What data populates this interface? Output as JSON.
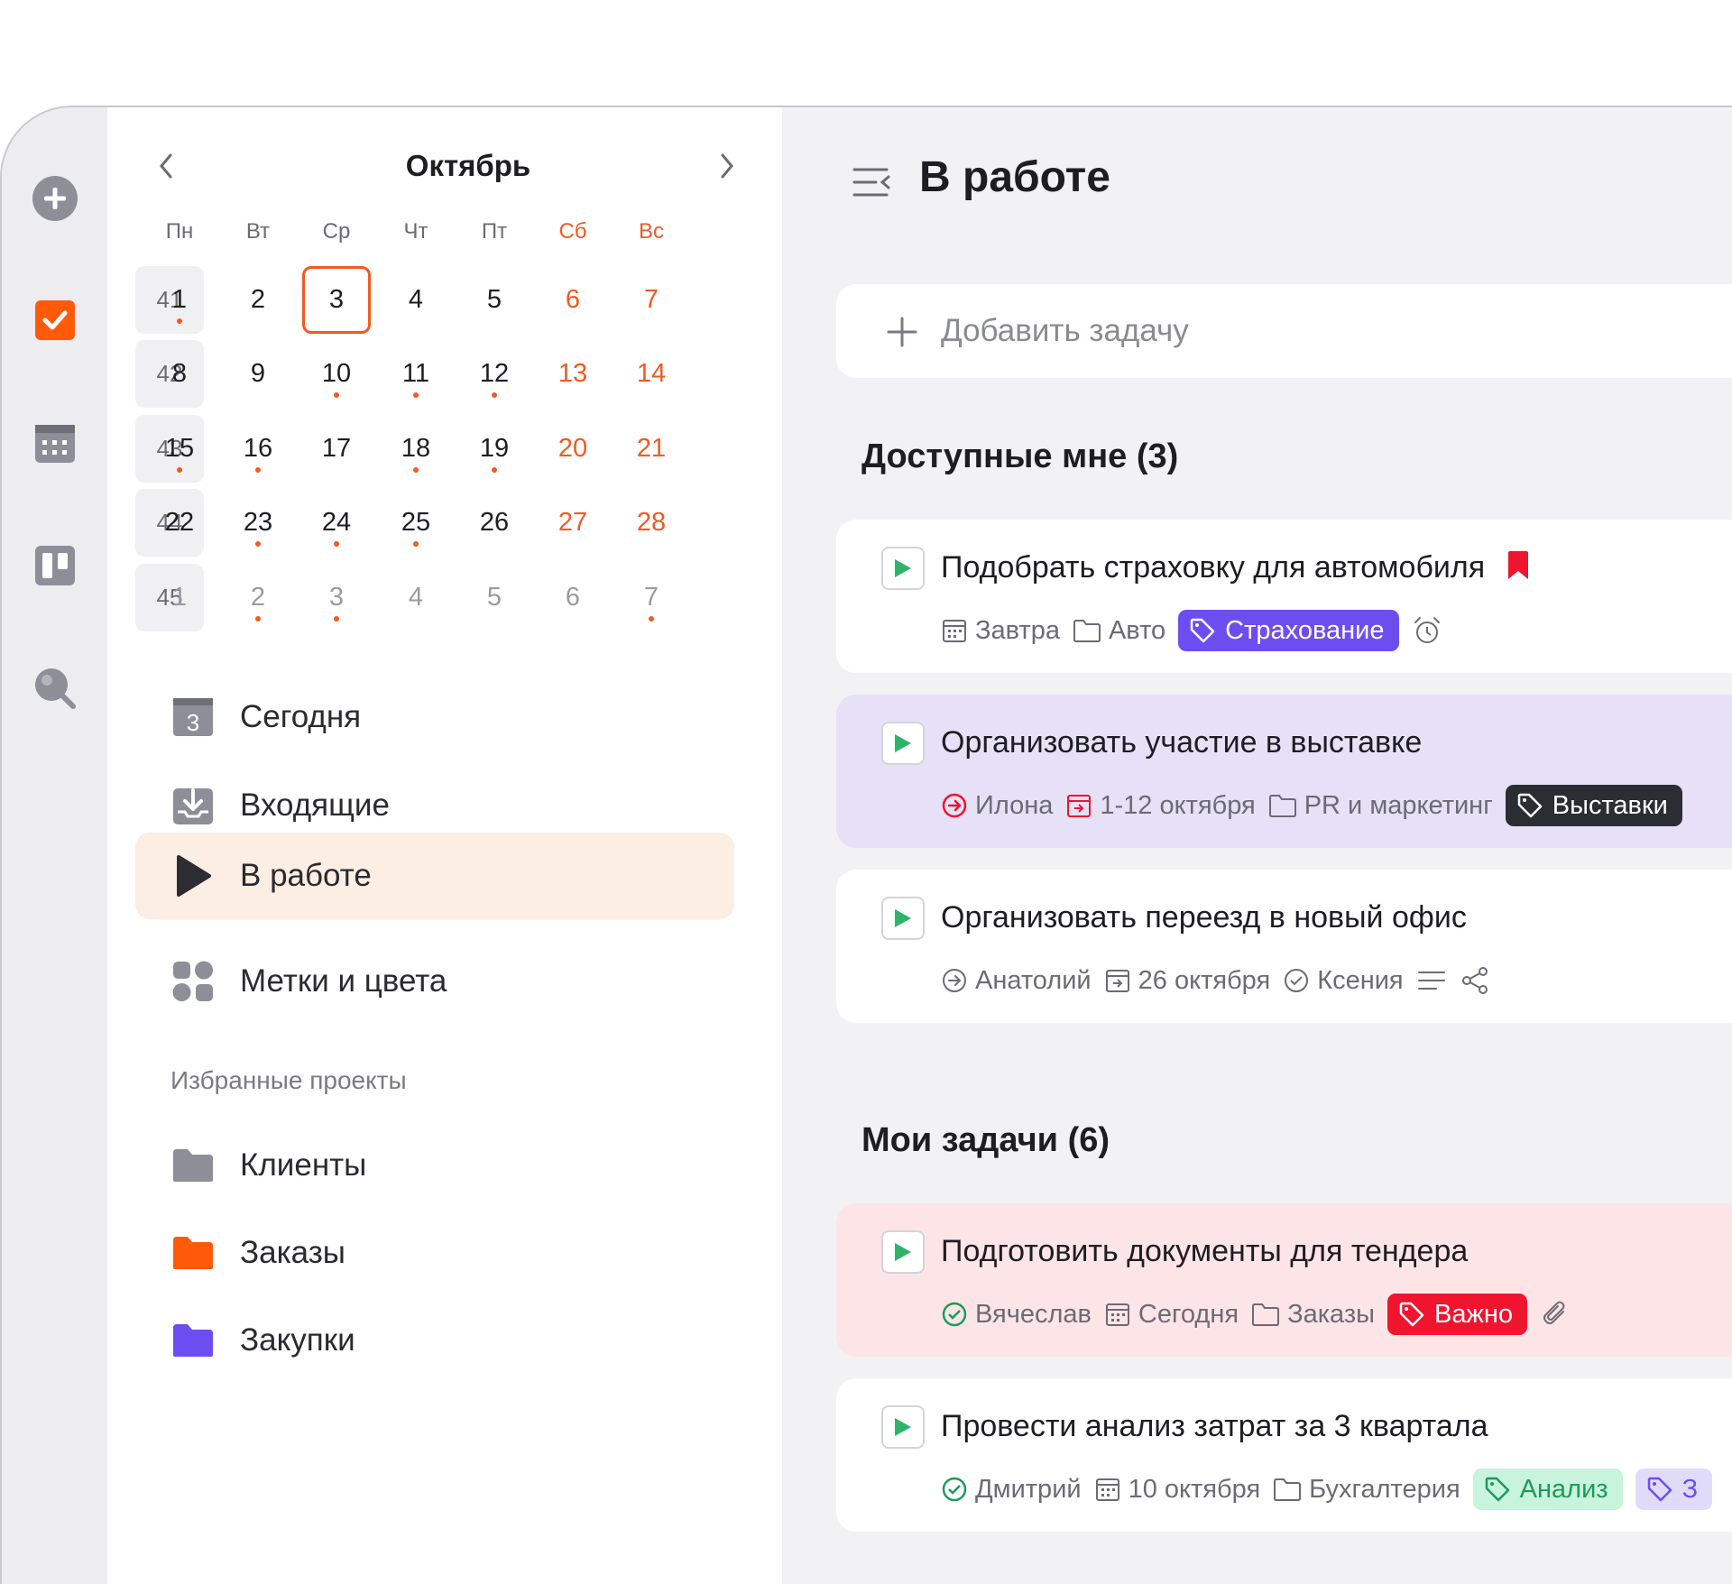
{
  "colors": {
    "accent": "#f15a22",
    "purple_tag": "#6c4ef0",
    "red_tag": "#f0142f",
    "dark_tag": "#2c2c33",
    "green_tag_bg": "#c8f3dc",
    "play_green": "#2fb36b"
  },
  "rail": {
    "icons": [
      "plus-circle-icon",
      "checkbox-icon",
      "calendar-icon",
      "board-icon",
      "search-icon"
    ]
  },
  "calendar": {
    "month": "Октябрь",
    "weekdays": [
      "Пн",
      "Вт",
      "Ср",
      "Чт",
      "Пт",
      "Сб",
      "Вс"
    ],
    "weeks": [
      {
        "num": "41",
        "days": [
          "1",
          "2",
          "3",
          "4",
          "5",
          "6",
          "7"
        ]
      },
      {
        "num": "42",
        "days": [
          "8",
          "9",
          "10",
          "11",
          "12",
          "13",
          "14"
        ]
      },
      {
        "num": "43",
        "days": [
          "15",
          "16",
          "17",
          "18",
          "19",
          "20",
          "21"
        ]
      },
      {
        "num": "44",
        "days": [
          "22",
          "23",
          "24",
          "25",
          "26",
          "27",
          "28"
        ]
      },
      {
        "num": "45",
        "days": [
          "1",
          "2",
          "3",
          "4",
          "5",
          "6",
          "7"
        ]
      }
    ],
    "selected_day": "3"
  },
  "nav": {
    "items": [
      {
        "label": "Сегодня",
        "icon": "today-icon",
        "badge": "3"
      },
      {
        "label": "Входящие",
        "icon": "inbox-icon"
      },
      {
        "label": "В работе",
        "icon": "play-icon",
        "active": true
      },
      {
        "label": "Метки и цвета",
        "icon": "tags-grid-icon"
      }
    ],
    "favorites_caption": "Избранные проекты",
    "projects": [
      {
        "label": "Клиенты",
        "color": "#8e8e99"
      },
      {
        "label": "Заказы",
        "color": "#ff5a0a"
      },
      {
        "label": "Закупки",
        "color": "#6c4ef0"
      }
    ]
  },
  "main": {
    "title": "В работе",
    "add_task_placeholder": "Добавить задачу",
    "groups": [
      {
        "title": "Доступные мне (3)",
        "tasks": [
          {
            "title": "Подобрать страховку для автомобиля",
            "date": "Завтра",
            "project": "Авто",
            "tag": "Страхование"
          },
          {
            "title": "Организовать участие в выставке",
            "assignee": "Илона",
            "date": "1-12 октября",
            "project": "PR и маркетинг",
            "tag": "Выставки"
          },
          {
            "title": "Организовать переезд в новый офис",
            "assignee": "Анатолий",
            "date": "26 октября",
            "checker": "Ксения"
          }
        ]
      },
      {
        "title": "Мои задачи (6)",
        "tasks": [
          {
            "title": "Подготовить документы для тендера",
            "assignee": "Вячеслав",
            "date": "Сегодня",
            "project": "Заказы",
            "tag": "Важно"
          },
          {
            "title": "Провести анализ затрат за 3 квартала",
            "assignee": "Дмитрий",
            "date": "10 октября",
            "project": "Бухгалтерия",
            "tag": "Анализ",
            "tag2": "З"
          }
        ]
      }
    ]
  }
}
